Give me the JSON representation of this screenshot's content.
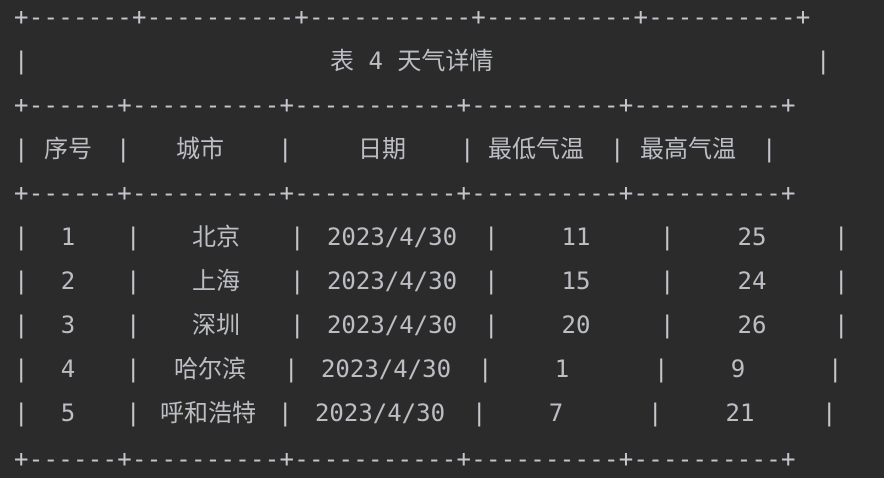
{
  "title": "表 4 天气详情",
  "border": "+-------+----------+----------+----------+----------+",
  "headers": [
    "序号",
    "城市",
    "日期",
    "最低气温",
    "最高气温"
  ],
  "rows": [
    {
      "index": "1",
      "city": "北京",
      "date": "2023/4/30",
      "low": "11",
      "high": "25"
    },
    {
      "index": "2",
      "city": "上海",
      "date": "2023/4/30",
      "low": "15",
      "high": "24"
    },
    {
      "index": "3",
      "city": "深圳",
      "date": "2023/4/30",
      "low": "20",
      "high": "26"
    },
    {
      "index": "4",
      "city": "哈尔滨",
      "date": "2023/4/30",
      "low": "1",
      "high": "9"
    },
    {
      "index": "5",
      "city": "呼和浩特",
      "date": "2023/4/30",
      "low": "7",
      "high": "21"
    }
  ],
  "colors": {
    "background": "#2b2b2b",
    "text": "#bcbec4"
  }
}
